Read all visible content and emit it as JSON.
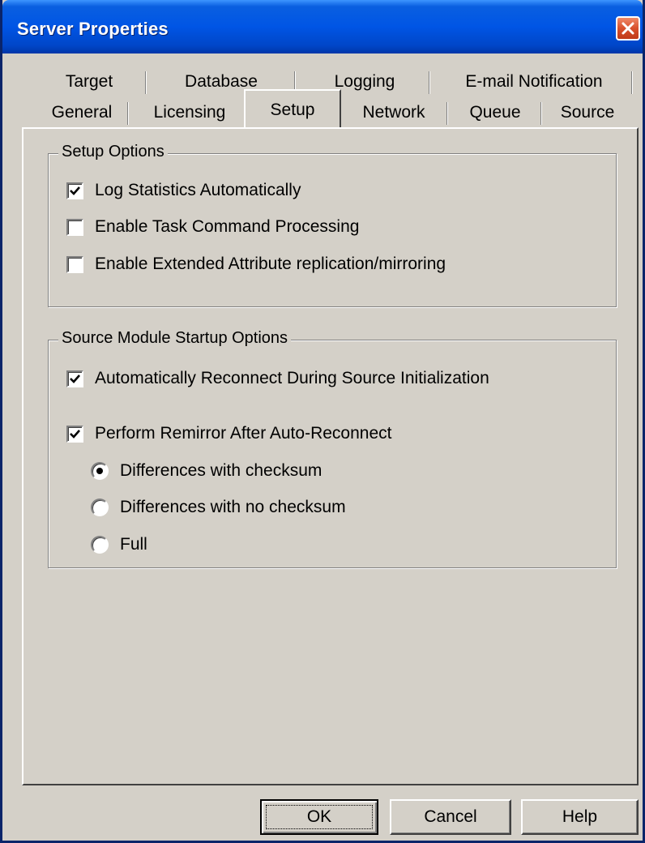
{
  "window": {
    "title": "Server Properties"
  },
  "tabs": {
    "row1": [
      "Target",
      "Database",
      "Logging",
      "E-mail Notification"
    ],
    "row2": [
      "General",
      "Licensing",
      "Setup",
      "Network",
      "Queue",
      "Source"
    ],
    "active": "Setup"
  },
  "setup_options": {
    "title": "Setup Options",
    "items": [
      {
        "label": "Log Statistics Automatically",
        "checked": true
      },
      {
        "label": "Enable Task Command Processing",
        "checked": false
      },
      {
        "label": "Enable Extended Attribute replication/mirroring",
        "checked": false
      }
    ]
  },
  "startup_options": {
    "title": "Source Module Startup Options",
    "auto_reconnect": {
      "label": "Automatically Reconnect During Source Initialization",
      "checked": true
    },
    "remirror": {
      "label": "Perform Remirror After Auto-Reconnect",
      "checked": true
    },
    "radios": [
      {
        "label": "Differences with checksum",
        "selected": true
      },
      {
        "label": "Differences with no checksum",
        "selected": false
      },
      {
        "label": "Full",
        "selected": false
      }
    ]
  },
  "buttons": {
    "ok": "OK",
    "cancel": "Cancel",
    "help": "Help"
  }
}
